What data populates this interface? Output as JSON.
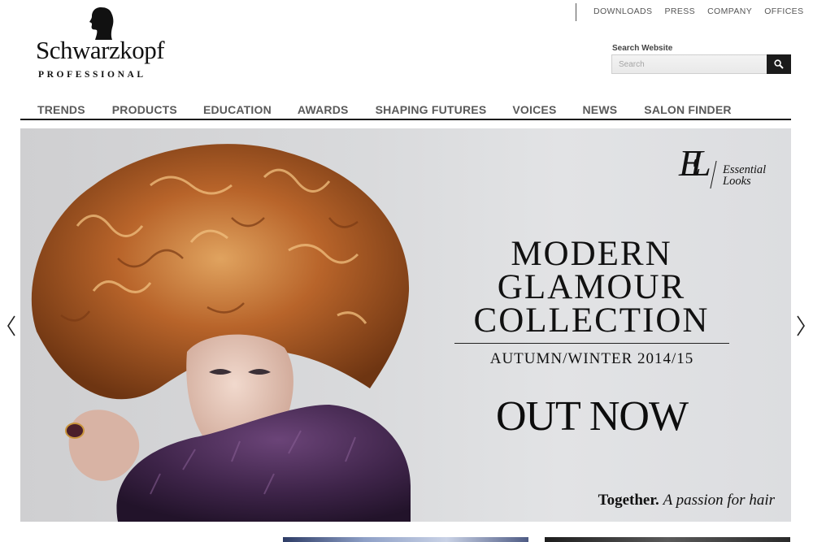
{
  "brand": {
    "name": "Schwarzkopf",
    "subtitle": "PROFESSIONAL"
  },
  "utility_nav": [
    {
      "label": "DOWNLOADS"
    },
    {
      "label": "PRESS"
    },
    {
      "label": "COMPANY"
    },
    {
      "label": "OFFICES"
    }
  ],
  "search": {
    "label": "Search Website",
    "placeholder": "Search",
    "value": ""
  },
  "main_nav": [
    {
      "label": "TRENDS"
    },
    {
      "label": "PRODUCTS"
    },
    {
      "label": "EDUCATION"
    },
    {
      "label": "AWARDS"
    },
    {
      "label": "SHAPING FUTURES"
    },
    {
      "label": "VOICES"
    },
    {
      "label": "NEWS"
    },
    {
      "label": "SALON FINDER"
    }
  ],
  "hero": {
    "badge_mark": "EL",
    "badge_text_line1": "Essential",
    "badge_text_line2": "Looks",
    "title_line1": "MODERN",
    "title_line2": "GLAMOUR",
    "title_line3": "COLLECTION",
    "season": "AUTUMN/WINTER 2014/15",
    "cta": "OUT NOW",
    "tagline_bold": "Together.",
    "tagline_italic": "A passion for hair"
  },
  "colors": {
    "nav_text": "#5a5a5a",
    "rule": "#1a1a1a",
    "search_button": "#1b1b1b",
    "hair": "#b8642a",
    "fur": "#4a2c55"
  },
  "icons": {
    "logo": "silhouette-head-icon",
    "search": "magnifier-icon",
    "prev": "chevron-left-icon",
    "next": "chevron-right-icon"
  }
}
